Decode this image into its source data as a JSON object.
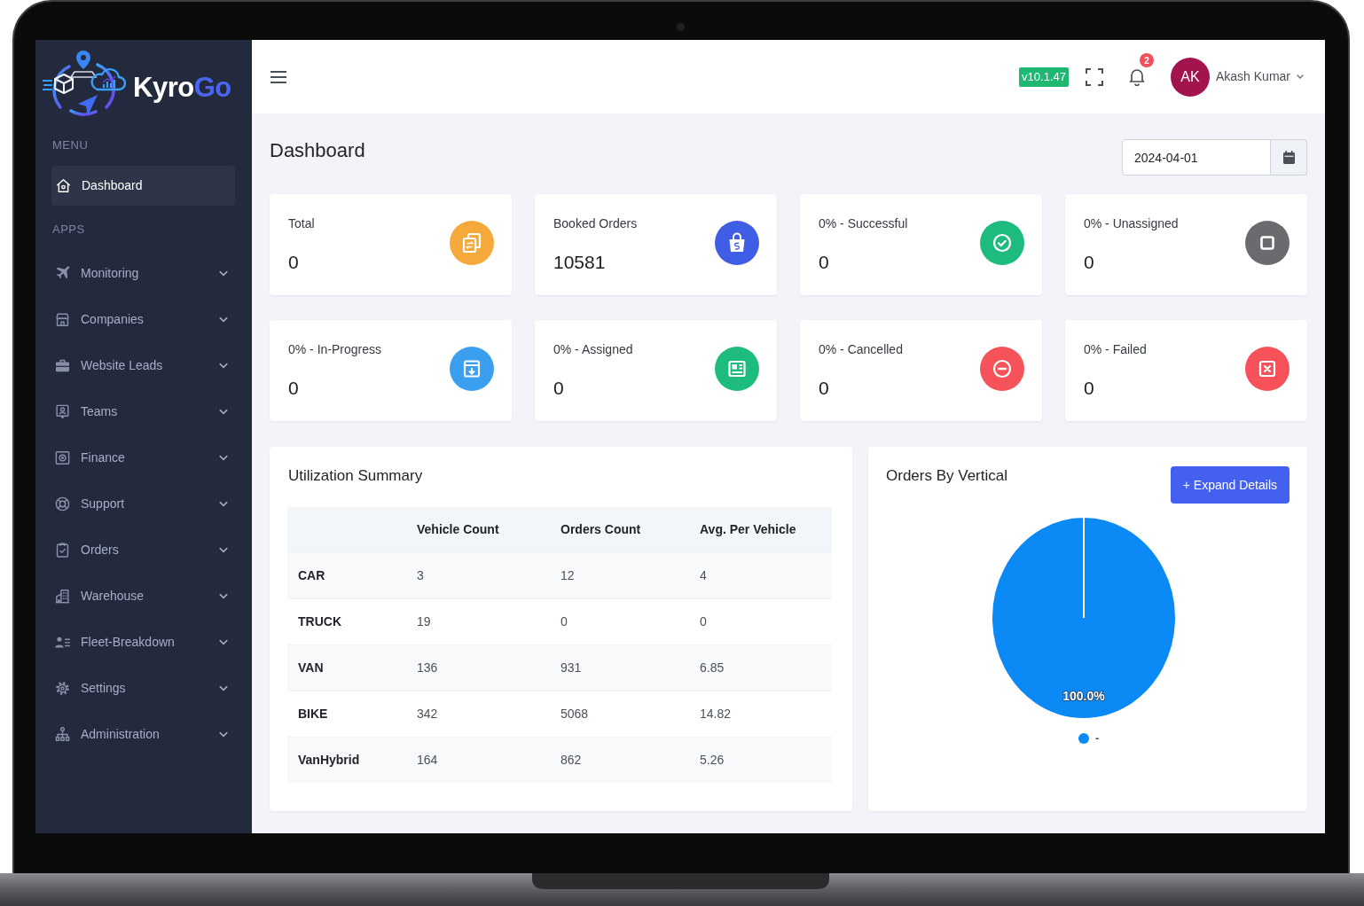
{
  "sidebar": {
    "logo": {
      "parts": [
        "Kyro",
        "Go"
      ]
    },
    "sections": [
      {
        "title": "MENU",
        "items": [
          {
            "label": "Dashboard",
            "selected": true
          }
        ]
      },
      {
        "title": "APPS",
        "items": [
          {
            "label": "Monitoring",
            "selected": false,
            "expanded": false
          },
          {
            "label": "Companies",
            "selected": false,
            "expanded": false
          },
          {
            "label": "Website Leads",
            "selected": false,
            "expanded": false
          },
          {
            "label": "Teams",
            "selected": false,
            "expanded": false
          },
          {
            "label": "Finance",
            "selected": false,
            "expanded": false
          },
          {
            "label": "Support",
            "selected": false,
            "expanded": false
          },
          {
            "label": "Orders",
            "selected": false,
            "expanded": false
          },
          {
            "label": "Warehouse",
            "selected": false,
            "expanded": false
          },
          {
            "label": "Fleet-Breakdown",
            "selected": false,
            "expanded": false
          },
          {
            "label": "Settings",
            "selected": false,
            "expanded": false
          },
          {
            "label": "Administration",
            "selected": false,
            "expanded": false
          }
        ]
      }
    ]
  },
  "top_bar": {
    "version": "v10.1.47",
    "notification_count": "2",
    "user": {
      "initials": "AK",
      "name": "Akash Kumar"
    }
  },
  "page": {
    "title": "Dashboard",
    "date": "2024-04-01"
  },
  "stats": [
    {
      "label": "Total",
      "value": "0",
      "color": "#f6a93b"
    },
    {
      "label": "Booked Orders",
      "value": "10581",
      "color": "#405de6"
    },
    {
      "label": "0% - Successful",
      "value": "0",
      "color": "#1dbb7d"
    },
    {
      "label": "0% - Unassigned",
      "value": "0",
      "color": "#6b6b6f"
    },
    {
      "label": "0% - In-Progress",
      "value": "0",
      "color": "#3b9ff0"
    },
    {
      "label": "0% - Assigned",
      "value": "0",
      "color": "#1dbb7d"
    },
    {
      "label": "0% - Cancelled",
      "value": "0",
      "color": "#f5525a"
    },
    {
      "label": "0% - Failed",
      "value": "0",
      "color": "#f5525a"
    }
  ],
  "utilization_summary": {
    "title": "Utilization Summary",
    "columns": [
      "Vehicle Count",
      "Orders Count",
      "Avg. Per Vehicle"
    ],
    "rows": [
      {
        "label": "CAR",
        "values": [
          "3",
          "12",
          "4"
        ]
      },
      {
        "label": "TRUCK",
        "values": [
          "19",
          "0",
          "0"
        ]
      },
      {
        "label": "VAN",
        "values": [
          "136",
          "931",
          "6.85"
        ]
      },
      {
        "label": "BIKE",
        "values": [
          "342",
          "5068",
          "14.82"
        ]
      },
      {
        "label": "VanHybrid",
        "values": [
          "164",
          "862",
          "5.26"
        ]
      }
    ]
  },
  "orders_by_vertical": {
    "button": "+ Expand Details",
    "chart_data": {
      "type": "pie",
      "title": "Orders By Vertical",
      "categories": [
        "-"
      ],
      "series": [
        {
          "color": "#0b89f4",
          "values": [
            100
          ]
        }
      ],
      "value_labels": [
        "100.0%"
      ]
    }
  }
}
